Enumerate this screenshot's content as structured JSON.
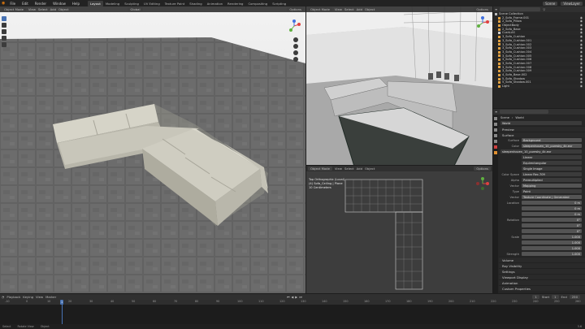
{
  "menu": {
    "items": [
      "File",
      "Edit",
      "Render",
      "Window",
      "Help"
    ],
    "workspaces": [
      "Layout",
      "Modeling",
      "Sculpting",
      "UV Editing",
      "Texture Paint",
      "Shading",
      "Animation",
      "Rendering",
      "Compositing",
      "Scripting"
    ],
    "active_workspace": "Layout",
    "scene_label": "Scene",
    "view_layer_label": "ViewLayer"
  },
  "left_viewport": {
    "header": [
      "Object Mode",
      "View",
      "Select",
      "Add",
      "Object"
    ],
    "transform": "Global",
    "options_label": "Options"
  },
  "top_right_viewport": {
    "header": [
      "Object Mode",
      "View",
      "Select",
      "Add",
      "Object"
    ],
    "options_label": "Options"
  },
  "bottom_viewport": {
    "header": [
      "Object Mode",
      "View",
      "Select",
      "Add",
      "Object"
    ],
    "options_label": "Options",
    "overlay_lines": [
      "Top Orthographic (Local)",
      "(4) Sofa_Ceiling | Plane",
      "10 Centimeters"
    ]
  },
  "outliner": {
    "title": "Scene Collection",
    "items": [
      {
        "label": "2_Sofa_Frame.001",
        "color": "#e0a040"
      },
      {
        "label": "2_Sofa_Pillow",
        "color": "#e0a040"
      },
      {
        "label": "ObjectBody",
        "color": "#e0a040"
      },
      {
        "label": "2_Sofa_Base",
        "color": "#e0a040"
      },
      {
        "label": "CushLAS",
        "color": "#cccccc"
      },
      {
        "label": "3_Sofa_Cushion",
        "color": "#e0a040"
      },
      {
        "label": "3_Sofa_Cushion.001",
        "color": "#e0a040"
      },
      {
        "label": "3_Sofa_Cushion.002",
        "color": "#e0a040"
      },
      {
        "label": "3_Sofa_Cushion.003",
        "color": "#e0a040"
      },
      {
        "label": "3_Sofa_Cushion.004",
        "color": "#e0a040"
      },
      {
        "label": "3_Sofa_Cushion.005",
        "color": "#e0a040"
      },
      {
        "label": "3_Sofa_Cushion.006",
        "color": "#e0a040"
      },
      {
        "label": "3_Sofa_Cushion.007",
        "color": "#e0a040"
      },
      {
        "label": "3_Sofa_Cushion.008",
        "color": "#e0a040"
      },
      {
        "label": "3_Sofa_Cushion.009",
        "color": "#e0a040"
      },
      {
        "label": "4_Sofa_Base.002",
        "color": "#e0a040"
      },
      {
        "label": "5_Sofa_Shadow",
        "color": "#e0a040"
      },
      {
        "label": "5_Sofa_Shadow.001",
        "color": "#e0a040"
      },
      {
        "label": "Light",
        "color": "#e0a040"
      }
    ]
  },
  "properties": {
    "breadcrumb": [
      "Scene",
      "World"
    ],
    "world_name": "World",
    "sections": {
      "preview": "Preview",
      "surface": "Surface",
      "volume": "Volume",
      "ray_visibility": "Ray Visibility",
      "settings": "Settings",
      "viewport_display": "Viewport Display",
      "animation": "Animation",
      "custom_properties": "Custom Properties"
    },
    "surface_label": "Surface",
    "surface_value": "Background",
    "color_label": "Color",
    "color_value": "sleepenhoven_10_puresky_4k.exr",
    "image_name": "sleepenhoven_10_puresky_4k.exr",
    "interp": "Linear",
    "projection": "Equirectangular",
    "extension": "Single Image",
    "color_space_label": "Color Space",
    "color_space": "Linear Rec.709",
    "alpha_label": "Alpha",
    "alpha": "Premultiplied",
    "vector_label": "Vector",
    "vector_value": "Mapping",
    "type_label": "Type",
    "type_value": "Point",
    "vector2_label": "Vector",
    "vector2_value": "Texture Coordinate | Generated",
    "location_label": "Location",
    "location": [
      "0 m",
      "0 m",
      "0 m"
    ],
    "rotation_label": "Rotation",
    "rotation": [
      "0°",
      "0°",
      "0°"
    ],
    "scale_label": "Scale",
    "scale": [
      "1.000",
      "1.000",
      "1.000"
    ],
    "strength_label": "Strength",
    "strength": "1.000"
  },
  "timeline": {
    "menu": [
      "Playback",
      "Keying",
      "View",
      "Marker"
    ],
    "start_label": "Start",
    "start": "1",
    "end_label": "End",
    "end": "250",
    "current_frame": "1",
    "ticks": [
      "-10",
      "0",
      "10",
      "20",
      "30",
      "40",
      "50",
      "60",
      "70",
      "80",
      "90",
      "100",
      "110",
      "120",
      "130",
      "140",
      "150",
      "160",
      "170",
      "180",
      "190",
      "200",
      "210",
      "220",
      "230",
      "240",
      "250",
      "260"
    ]
  },
  "status": {
    "items": [
      "Select",
      "Rotate View",
      "Object"
    ],
    "version": "3.6"
  }
}
